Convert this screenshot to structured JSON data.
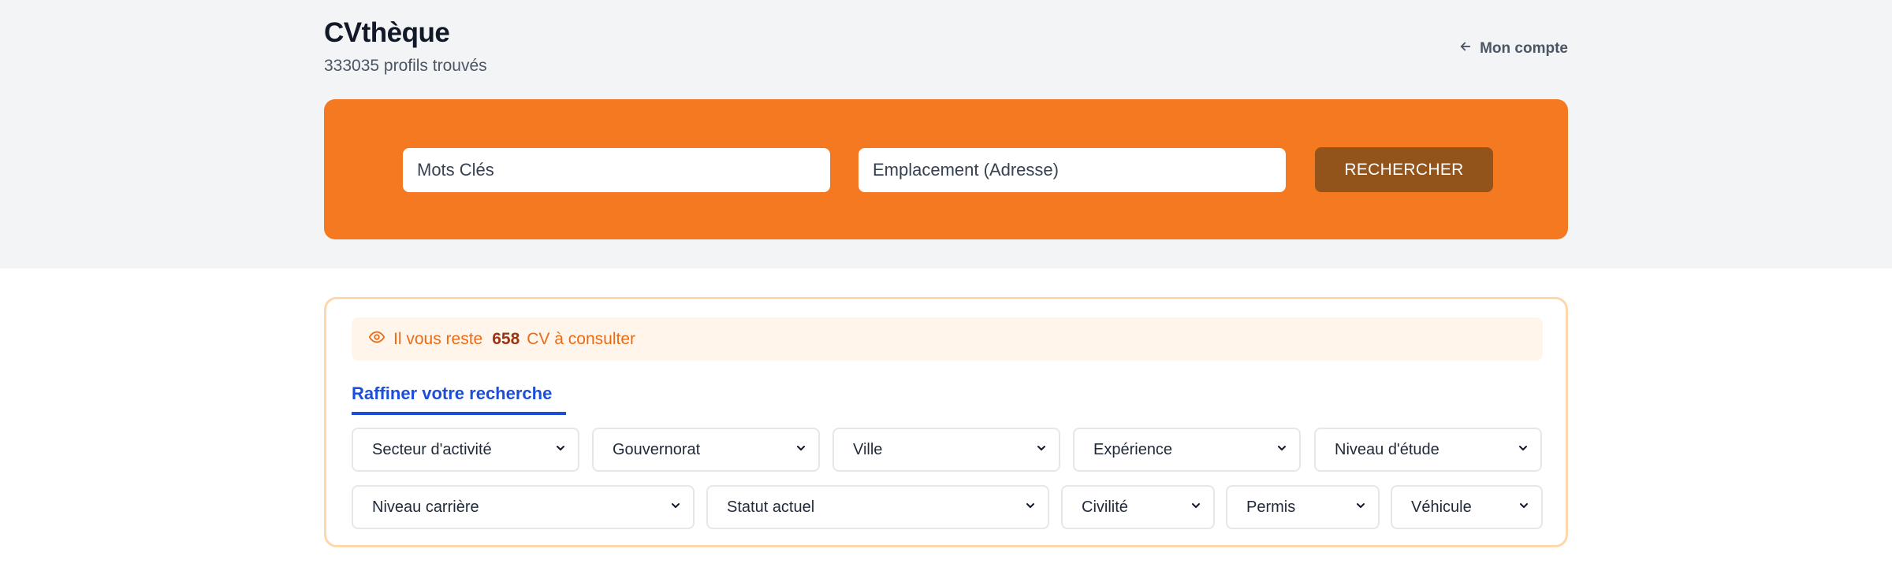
{
  "header": {
    "title": "CVthèque",
    "subtitle": "333035 profils trouvés",
    "account_link": "Mon compte"
  },
  "search": {
    "keywords_placeholder": "Mots Clés",
    "location_placeholder": "Emplacement (Adresse)",
    "button_label": "RECHERCHER"
  },
  "quota": {
    "prefix": "Il vous reste",
    "count": "658",
    "suffix": "CV à consulter"
  },
  "refine": {
    "tab_label": "Raffiner votre recherche"
  },
  "filters": {
    "row1": [
      "Secteur d'activité",
      "Gouvernorat",
      "Ville",
      "Expérience",
      "Niveau d'étude"
    ],
    "row2": [
      "Niveau carrière",
      "Statut actuel",
      "Civilité",
      "Permis",
      "Véhicule"
    ]
  },
  "icons": {
    "account": "arrow-left-icon",
    "quota": "eye-icon",
    "select": "chevron-down-icon"
  },
  "colors": {
    "search_panel": "#f47920",
    "search_button": "#93541b",
    "refine_tab": "#1d4ed8",
    "quota_text": "#ea6b14"
  }
}
